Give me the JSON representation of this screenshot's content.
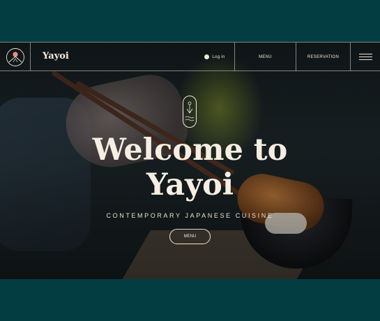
{
  "brand": {
    "name": "Yayoi",
    "logo_icon": "mountain-sun-icon"
  },
  "nav": {
    "login_label": "Log in",
    "login_icon": "user-icon",
    "menu_label": "MENU",
    "reservation_label": "RESERVATION",
    "hamburger_icon": "hamburger-menu-icon"
  },
  "hero": {
    "emblem_icon": "anchor-waves-icon",
    "title_line1": "Welcome to",
    "title_line2": "Yayoi",
    "subtitle": "CONTEMPORARY JAPANESE CUISINE",
    "menu_button_label": "MENU"
  },
  "colors": {
    "page_background": "#033d42",
    "text": "#f6eee2",
    "logo_sun": "#e8927c"
  }
}
